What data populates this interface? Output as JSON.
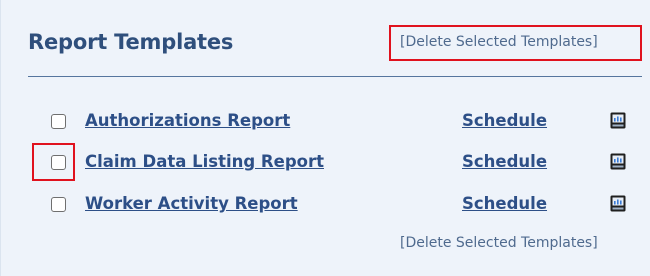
{
  "panel": {
    "title": "Report Templates",
    "delete_selected_top": "[Delete Selected Templates]",
    "delete_selected_bottom": "[Delete Selected Templates]"
  },
  "reports": [
    {
      "name": "Authorizations Report",
      "schedule_label": "Schedule",
      "checked": false
    },
    {
      "name": "Claim Data Listing Report",
      "schedule_label": "Schedule",
      "checked": false
    },
    {
      "name": "Worker Activity Report",
      "schedule_label": "Schedule",
      "checked": false
    }
  ],
  "icons": {
    "report": "report-icon"
  },
  "colors": {
    "panel_bg": "#eef3fa",
    "title": "#2f4f7c",
    "link": "#2d4f87",
    "highlight": "#e0121e"
  }
}
